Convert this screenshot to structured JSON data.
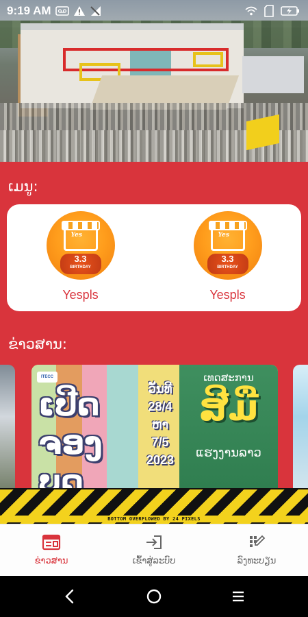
{
  "status_bar": {
    "time": "9:19 AM",
    "icons": [
      "voicemail-icon",
      "warning-icon",
      "no-signal-icon",
      "wifi-icon",
      "sim-card-icon",
      "battery-charging-icon"
    ]
  },
  "hero": {
    "image": "shopping-mall-aerial-photo"
  },
  "menu": {
    "title": "ເມນູ:",
    "items": [
      {
        "label": "Yespls",
        "logo": {
          "brand": "Yes",
          "badge_big": "3.3",
          "badge_small": "BIRTHDAY"
        }
      },
      {
        "label": "Yespls",
        "logo": {
          "brand": "Yes",
          "badge_big": "3.3",
          "badge_small": "BIRTHDAY"
        }
      }
    ]
  },
  "news": {
    "title": "ຂ່າວສານ:",
    "featured": {
      "org": "ITECC",
      "headline": "ເປີດຈອງບູດ",
      "date_prefix": "ວັນທີ",
      "date_from": "28/4",
      "date_sep": "ຫາ",
      "date_to": "7/5",
      "year": "2023",
      "event_label": "ເທດສະການ",
      "event_big": "ສີມື",
      "event_sub": "ແຮງງານລາວ"
    }
  },
  "overflow_warning": "BOTTOM OVERFLOWED BY 24 PIXELS",
  "bottom_nav": {
    "items": [
      {
        "label": "ຂ່າວສານ",
        "icon": "newspaper-icon",
        "active": true
      },
      {
        "label": "ເຂົ້າສູ່ລະບົບ",
        "icon": "login-icon",
        "active": false
      },
      {
        "label": "ລົງທະບຽນ",
        "icon": "register-icon",
        "active": false
      }
    ]
  },
  "colors": {
    "primary": "#d9343c",
    "card_bg": "#ffffff",
    "nav_inactive": "#666666",
    "warning_yellow": "#f3d21d"
  }
}
